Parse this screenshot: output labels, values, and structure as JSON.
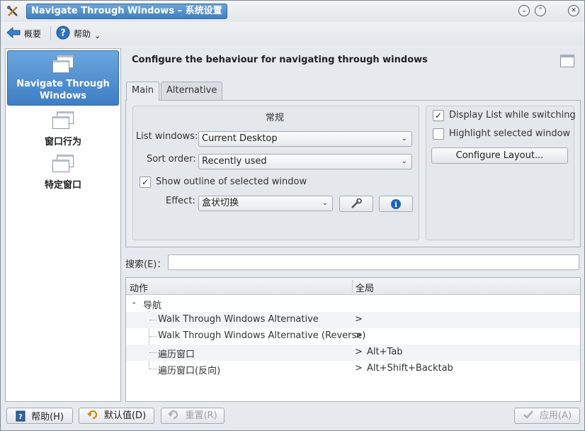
{
  "window": {
    "title": "Navigate Through Windows – 系统设置",
    "shade_glyph": "⌄",
    "max_glyph": "⌃",
    "close_glyph": "✕"
  },
  "toolbar": {
    "overview_label": "概要",
    "help_label": "帮助",
    "help_menu_glyph": "⌄"
  },
  "sidebar": {
    "items": [
      {
        "label": "Navigate Through Windows",
        "icon": "window-stack-icon",
        "active": true
      },
      {
        "label": "窗口行为",
        "icon": "window-stack-icon",
        "active": false
      },
      {
        "label": "特定窗口",
        "icon": "window-stack-icon",
        "active": false
      }
    ]
  },
  "main": {
    "title": "Configure the behaviour for navigating through windows",
    "tabs": [
      {
        "label": "Main",
        "active": true
      },
      {
        "label": "Alternative",
        "active": false
      }
    ],
    "group_title": "常规",
    "list_windows_label": "List windows:",
    "list_windows_value": "Current Desktop",
    "sort_order_label": "Sort order:",
    "sort_order_value": "Recently used",
    "show_outline_label": "Show outline of selected window",
    "show_outline_checked": true,
    "effect_label": "Effect:",
    "effect_value": "盒状切换",
    "display_list_label": "Display List while switching",
    "display_list_checked": true,
    "highlight_label": "Highlight selected window",
    "highlight_checked": false,
    "configure_layout_label": "Configure Layout...",
    "combo_arrow_glyph": "⌄",
    "check_glyph": "✓"
  },
  "shortcuts": {
    "search_label": "搜索(E)：",
    "search_value": "",
    "columns": [
      "动作",
      "全局"
    ],
    "category": {
      "expander": "-",
      "label": "导航"
    },
    "rows": [
      {
        "action": "Walk Through Windows Alternative",
        "marker": ">",
        "shortcut": ""
      },
      {
        "action": "Walk Through Windows Alternative (Reverse)",
        "marker": ">",
        "shortcut": ""
      },
      {
        "action": "遍历窗口",
        "marker": ">",
        "shortcut": "Alt+Tab"
      },
      {
        "action": "遍历窗口(反向)",
        "marker": ">",
        "shortcut": "Alt+Shift+Backtab"
      }
    ]
  },
  "footer": {
    "help_label": "帮助(H)",
    "defaults_label": "默认值(D)",
    "reset_label": "重置(R)",
    "apply_label": "应用(A)"
  },
  "colors": {
    "accent": "#3f7fc0",
    "selection": "#5b9ad6",
    "info_blue": "#1a63b8"
  }
}
